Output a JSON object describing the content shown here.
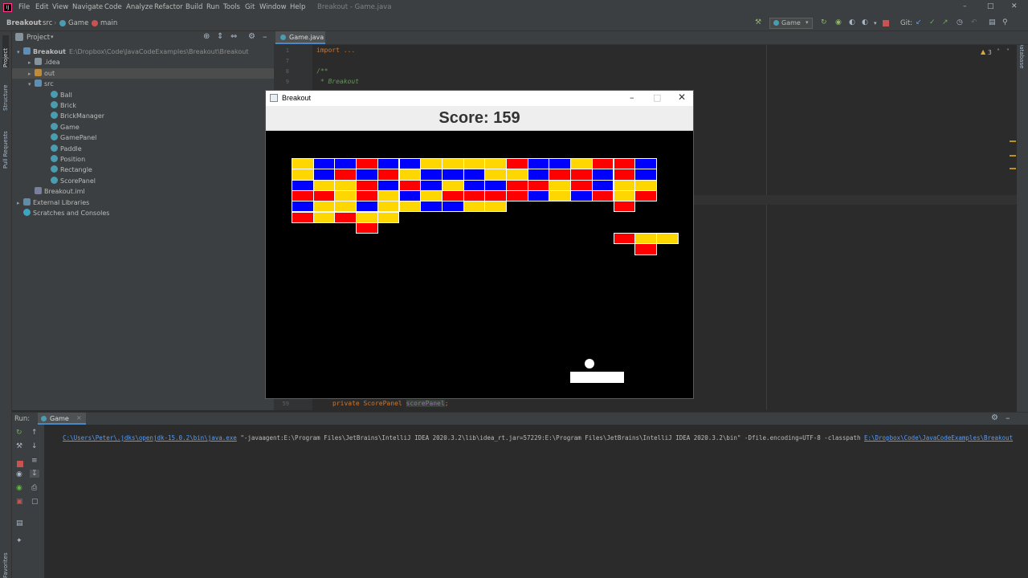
{
  "ide": {
    "logo": "IJ",
    "menu": [
      "File",
      "Edit",
      "View",
      "Navigate",
      "Code",
      "Analyze",
      "Refactor",
      "Build",
      "Run",
      "Tools",
      "Git",
      "Window",
      "Help"
    ],
    "window_title": "Breakout - Game.java",
    "breadcrumbs": [
      "Breakout",
      "src",
      "Game",
      "main"
    ],
    "run_config": "Game",
    "git_label": "Git:"
  },
  "project_panel": {
    "title": "Project",
    "items": [
      {
        "label": "Breakout",
        "detail": "E:\\Dropbox\\Code\\JavaCodeExamples\\Breakout\\Breakout",
        "icon": "module-folder-icon",
        "level": 0,
        "expanded": true
      },
      {
        "label": ".idea",
        "icon": "folder-icon",
        "level": 1,
        "expanded": false
      },
      {
        "label": "out",
        "icon": "excluded-folder-icon",
        "level": 1,
        "expanded": false,
        "selected": true
      },
      {
        "label": "src",
        "icon": "source-folder-icon",
        "level": 1,
        "expanded": true
      },
      {
        "label": "Ball",
        "icon": "class-icon",
        "level": 2
      },
      {
        "label": "Brick",
        "icon": "class-icon",
        "level": 2
      },
      {
        "label": "BrickManager",
        "icon": "class-icon",
        "level": 2
      },
      {
        "label": "Game",
        "icon": "class-icon",
        "level": 2
      },
      {
        "label": "GamePanel",
        "icon": "class-icon",
        "level": 2
      },
      {
        "label": "Paddle",
        "icon": "class-icon",
        "level": 2
      },
      {
        "label": "Position",
        "icon": "class-icon",
        "level": 2
      },
      {
        "label": "Rectangle",
        "icon": "class-icon",
        "level": 2
      },
      {
        "label": "ScorePanel",
        "icon": "class-icon",
        "level": 2
      },
      {
        "label": "Breakout.iml",
        "icon": "module-file-icon",
        "level": 1
      },
      {
        "label": "External Libraries",
        "icon": "library-icon",
        "level": 0,
        "expanded": false
      },
      {
        "label": "Scratches and Consoles",
        "icon": "scratches-icon",
        "level": 0
      }
    ]
  },
  "side_tabs": {
    "left": [
      "Project",
      "Structure",
      "Pull Requests"
    ],
    "right": [
      "Database"
    ],
    "bottom_left": "Favorites"
  },
  "editor": {
    "tab": "Game.java",
    "warnings": "3",
    "lines": [
      {
        "no": "1",
        "text": "import ...",
        "color": "#cc7832"
      },
      {
        "no": "7",
        "text": "",
        "color": "#a9b7c6"
      },
      {
        "no": "8",
        "text": "/**",
        "color": "#629755"
      },
      {
        "no": "9",
        "text": " * Breakout",
        "color": "#629755"
      }
    ],
    "bottom_line": {
      "no": "59",
      "prefix": "private ScorePanel ",
      "highlight": "scorePanel",
      "suffix": ";"
    }
  },
  "run_panel": {
    "label": "Run:",
    "tab": "Game",
    "cmd_path": "C:\\Users\\Peter\\.jdks\\openjdk-15.0.2\\bin\\java.exe",
    "cmd_args": " \"-javaagent:E:\\Program Files\\JetBrains\\IntelliJ IDEA 2020.3.2\\lib\\idea_rt.jar=57229:E:\\Program Files\\JetBrains\\IntelliJ IDEA 2020.3.2\\bin\" -Dfile.encoding=UTF-8 -classpath ",
    "cmd_link": "E:\\Dropbox\\Code\\JavaCodeExamples\\Breakout"
  },
  "game": {
    "window_title": "Breakout",
    "score_label": "Score:",
    "score": "159",
    "colors": {
      "yellow": "#ffd700",
      "blue": "#0000ff",
      "red": "#ff0000"
    },
    "grid": [
      "YBBRBBYYYYRBBYRRB",
      "YBRBRYBBBYYBRRBRB",
      "BYYRBRBYBBRRYRBYY",
      "RRYRYBYRRRRBYBRYR",
      "BYYBYYBBYY.....R.",
      "RYRYY............",
      "...R.............",
      "...............RYY",
      "................R"
    ],
    "paddle_label": "paddle",
    "ball_label": "ball"
  }
}
